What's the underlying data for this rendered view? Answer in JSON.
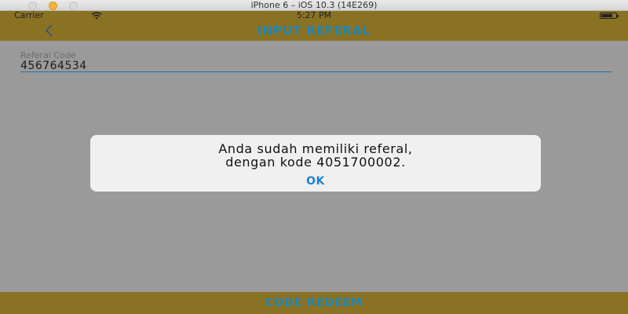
{
  "window": {
    "title": "iPhone 6 – iOS 10.3 (14E269)"
  },
  "status_bar": {
    "carrier": "Carrier",
    "time": "5:27 PM",
    "wifi_icon": "wifi-icon",
    "battery_icon": "battery-icon"
  },
  "nav": {
    "title": "INPUT REFERAL",
    "back_icon": "chevron-left-icon"
  },
  "form": {
    "label": "Referal Code",
    "value": "456764534"
  },
  "alert": {
    "message_line1": "Anda sudah memiliki referal,",
    "message_line2": "dengan kode 4051700002.",
    "ok_label": "OK"
  },
  "bottom": {
    "label": "CODE REDEEM"
  },
  "colors": {
    "bar": "#8a7225",
    "accent": "#1b86b8",
    "ok": "#1e7fd6",
    "overlay": "#9a9a9a"
  }
}
